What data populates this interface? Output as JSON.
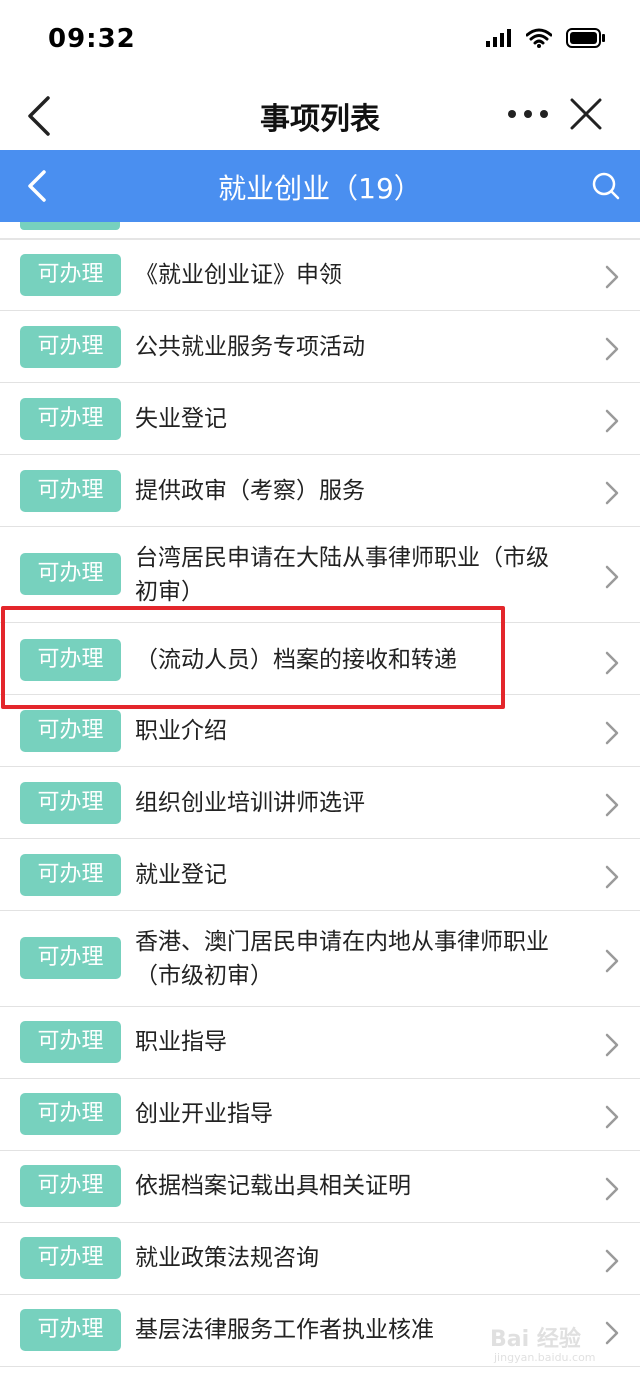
{
  "status_bar": {
    "time": "09:32"
  },
  "nav": {
    "title": "事项列表"
  },
  "header": {
    "title": "就业创业（19）"
  },
  "items": [
    {
      "badge": "可办理",
      "label": "《就业创业证》申领"
    },
    {
      "badge": "可办理",
      "label": "公共就业服务专项活动"
    },
    {
      "badge": "可办理",
      "label": "失业登记"
    },
    {
      "badge": "可办理",
      "label": "提供政审（考察）服务"
    },
    {
      "badge": "可办理",
      "label": "台湾居民申请在大陆从事律师职业（市级初审）"
    },
    {
      "badge": "可办理",
      "label": "（流动人员）档案的接收和转递"
    },
    {
      "badge": "可办理",
      "label": "职业介绍"
    },
    {
      "badge": "可办理",
      "label": "组织创业培训讲师选评"
    },
    {
      "badge": "可办理",
      "label": "就业登记"
    },
    {
      "badge": "可办理",
      "label": "香港、澳门居民申请在内地从事律师职业（市级初审）"
    },
    {
      "badge": "可办理",
      "label": "职业指导"
    },
    {
      "badge": "可办理",
      "label": "创业开业指导"
    },
    {
      "badge": "可办理",
      "label": "依据档案记载出具相关证明"
    },
    {
      "badge": "可办理",
      "label": "就业政策法规咨询"
    },
    {
      "badge": "可办理",
      "label": "基层法律服务工作者执业核准"
    }
  ],
  "watermark": {
    "text": "Bai 经验",
    "sub": "jingyan.baidu.com"
  },
  "colors": {
    "header_blue": "#4a8ff0",
    "badge_green": "#77d1be",
    "highlight_red": "#e3262b"
  }
}
